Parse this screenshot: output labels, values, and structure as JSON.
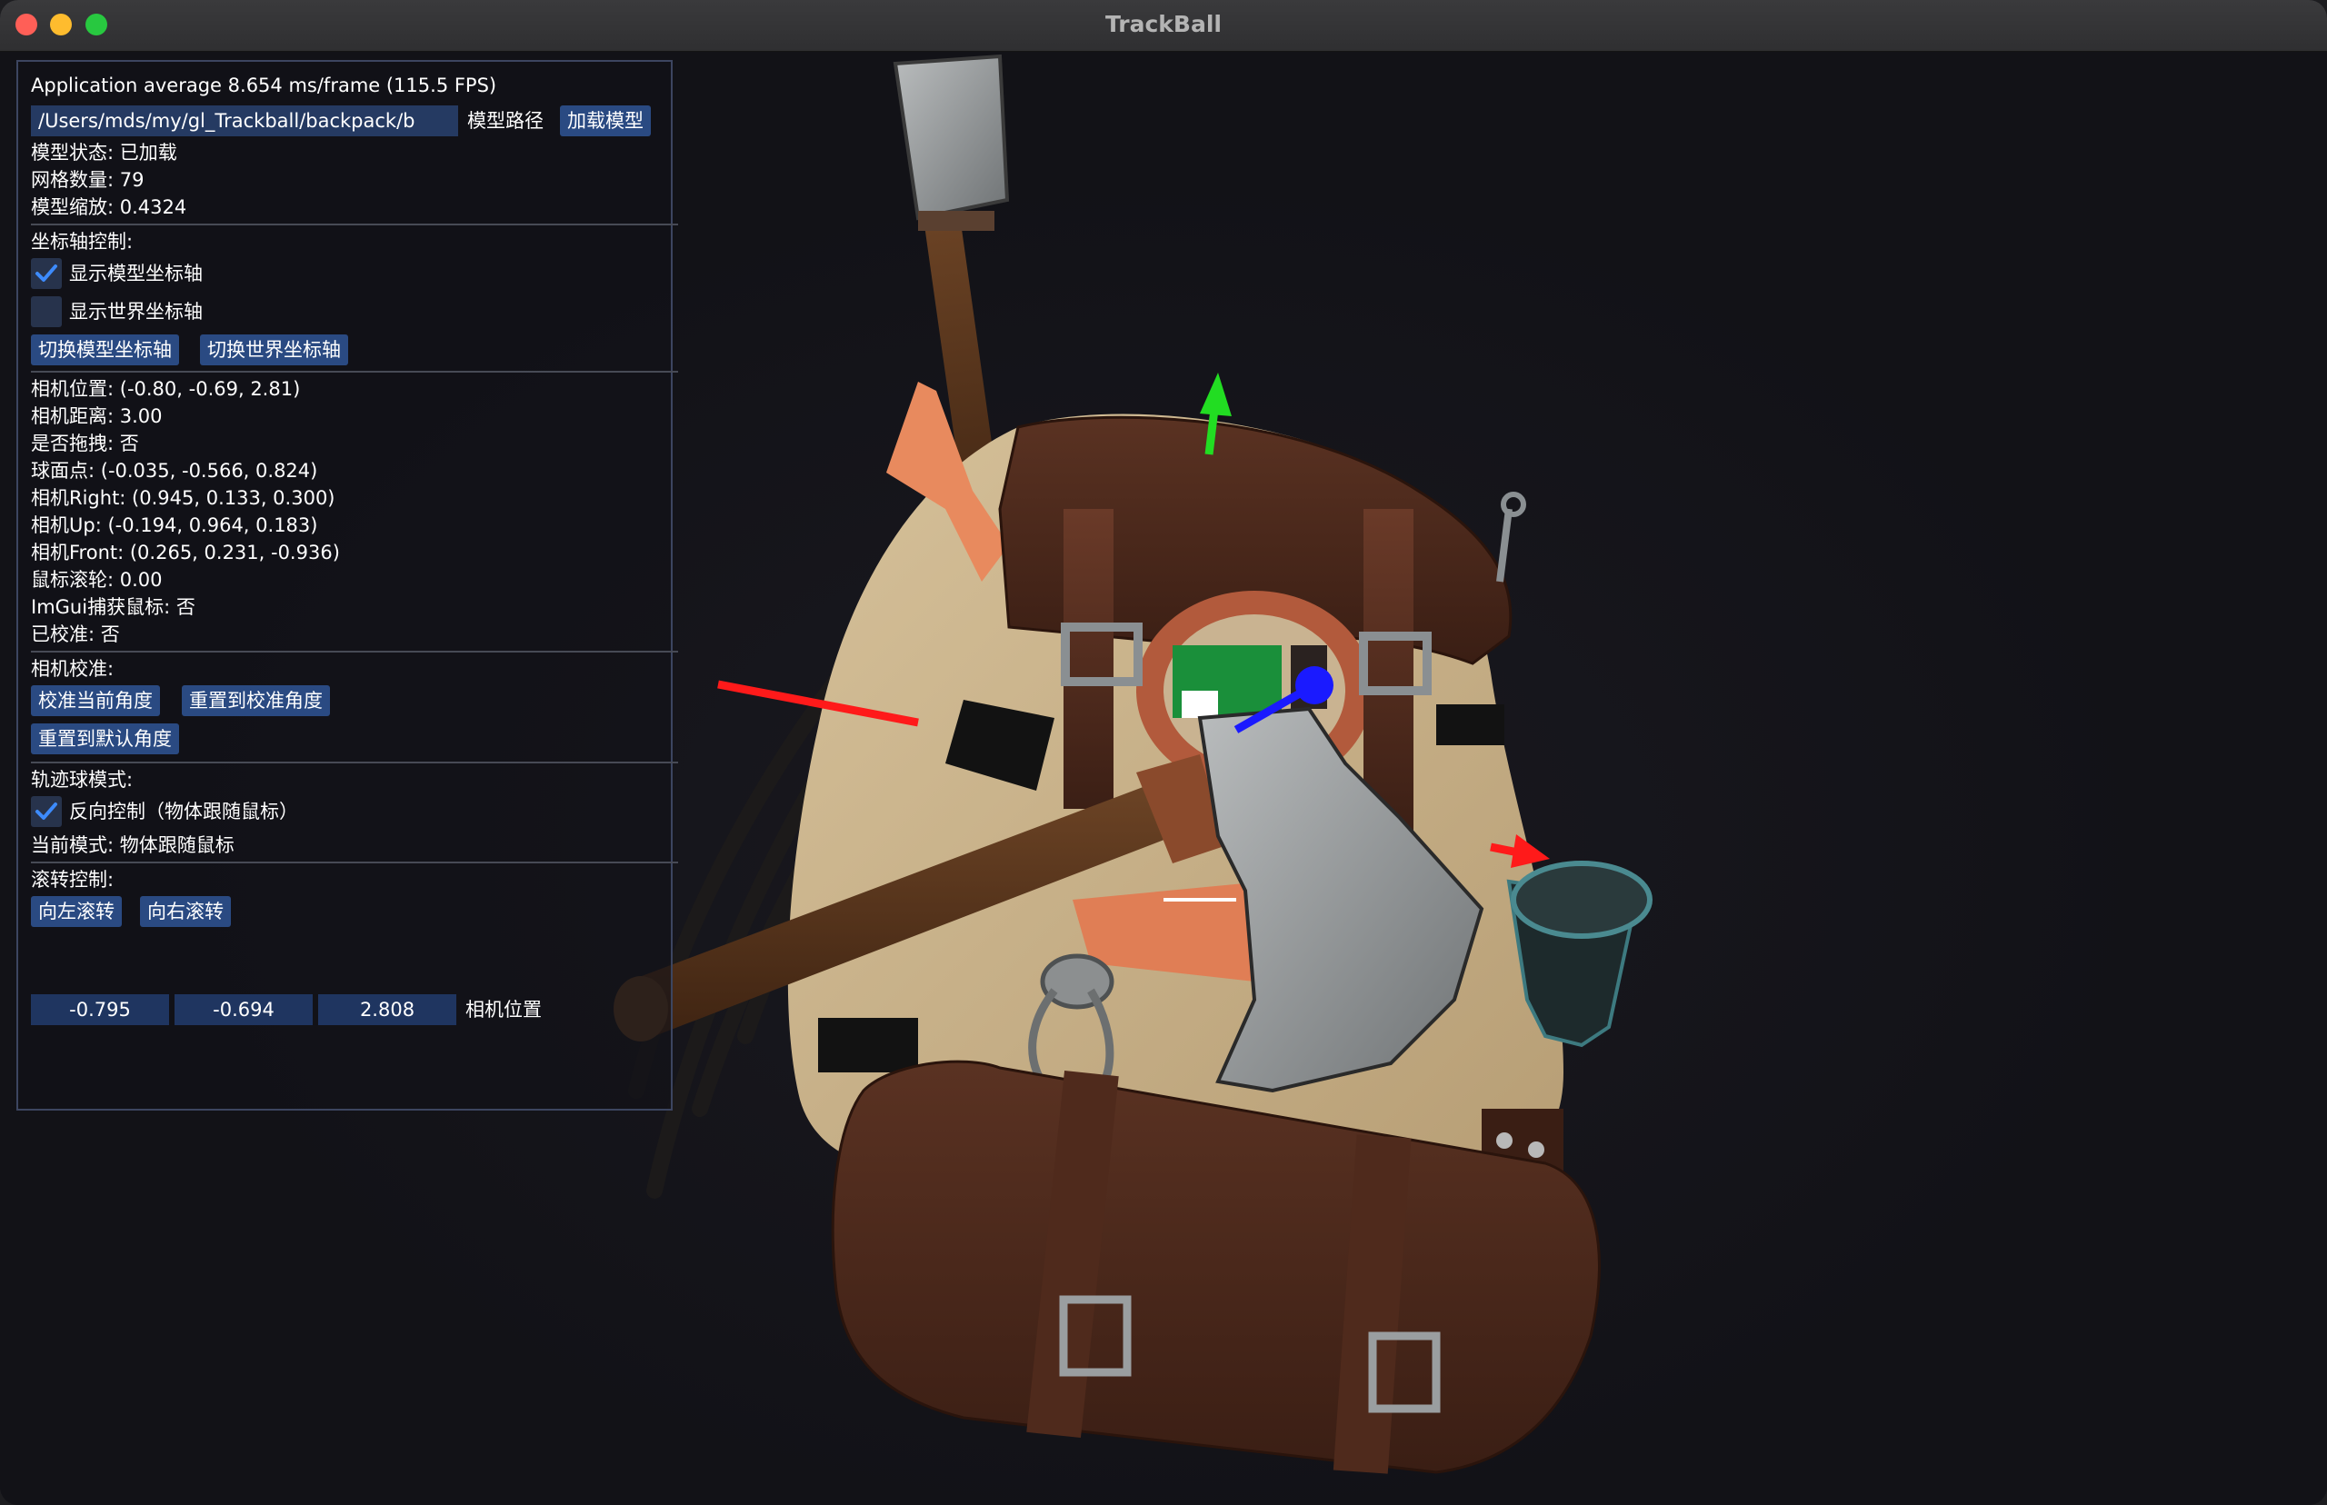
{
  "window": {
    "title": "TrackBall"
  },
  "panel": {
    "fps": "Application average 8.654 ms/frame (115.5 FPS)",
    "model_path_value": "/Users/mds/my/gl_Trackball/backpack/b",
    "model_path_label": "模型路径",
    "load_button": "加载模型",
    "model_status": "模型状态: 已加载",
    "mesh_count": "网格数量: 79",
    "model_scale": "模型缩放: 0.4324",
    "axis_section": "坐标轴控制:",
    "show_model_axis_label": "显示模型坐标轴",
    "show_model_axis_checked": true,
    "show_world_axis_label": "显示世界坐标轴",
    "show_world_axis_checked": false,
    "toggle_model_axis_button": "切换模型坐标轴",
    "toggle_world_axis_button": "切换世界坐标轴",
    "camera_pos": "相机位置: (-0.80, -0.69, 2.81)",
    "camera_dist": "相机距离: 3.00",
    "dragging": "是否拖拽: 否",
    "sphere_point": "球面点: (-0.035, -0.566, 0.824)",
    "camera_right": "相机Right: (0.945, 0.133, 0.300)",
    "camera_up": "相机Up: (-0.194, 0.964, 0.183)",
    "camera_front": "相机Front: (0.265, 0.231, -0.936)",
    "mouse_wheel": "鼠标滚轮: 0.00",
    "imgui_capture": "ImGui捕获鼠标: 否",
    "calibrated": "已校准: 否",
    "calib_section": "相机校准:",
    "calib_current_button": "校准当前角度",
    "reset_calib_button": "重置到校准角度",
    "reset_default_button": "重置到默认角度",
    "trackball_section": "轨迹球模式:",
    "reverse_control_label": "反向控制（物体跟随鼠标）",
    "reverse_control_checked": true,
    "current_mode": "当前模式: 物体跟随鼠标",
    "roll_section": "滚转控制:",
    "roll_left_button": "向左滚转",
    "roll_right_button": "向右滚转",
    "camera_pos_x": "-0.795",
    "camera_pos_y": "-0.694",
    "camera_pos_z": "2.808",
    "camera_pos_label": "相机位置"
  },
  "colors": {
    "accent": "#2a4a82",
    "checkmark": "#3d8bfd",
    "axis_x": "#ff1a1a",
    "axis_y": "#22dd22",
    "axis_z": "#1a1aff"
  },
  "scene": {
    "object": "backpack"
  }
}
